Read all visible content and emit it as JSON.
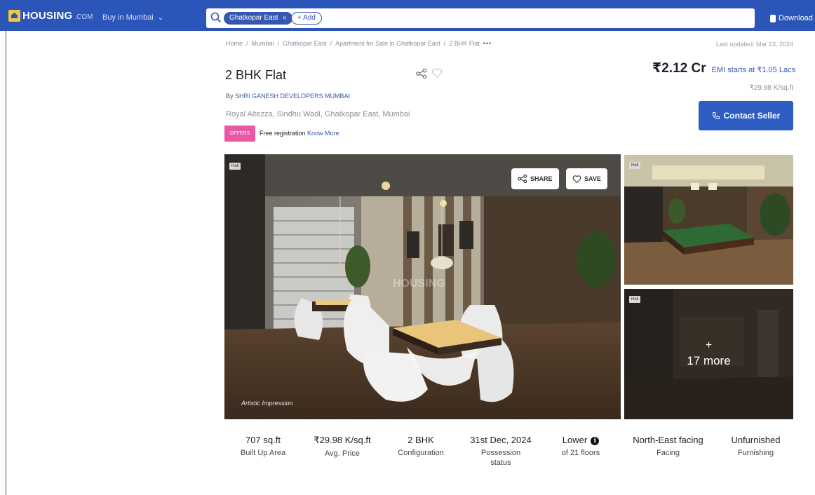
{
  "header": {
    "logo_text": "HOUSING",
    "logo_sub": ".COM",
    "city_select": "Buy in Mumbai",
    "search_chip": "Ghatkopar East",
    "add_label": "+ Add",
    "download_label": "Download A"
  },
  "breadcrumb": [
    "Home",
    "Mumbai",
    "Ghatkopar East",
    "Apartment for Sale in Ghatkopar East",
    "2 BHK Flat"
  ],
  "breadcrumb_more": "•••",
  "last_updated": "Last updated: Mar 23, 2024",
  "listing": {
    "title": "2 BHK Flat",
    "developer_prefix": "By",
    "developer": "SHRI GANESH DEVELOPERS MUMBAI",
    "address": "Royal Altezza, Sindhu Wadi, Ghatkopar East, Mumbai",
    "price": "₹2.12 Cr",
    "emi": "EMI starts at ₹1.05 Lacs",
    "price_per_sqft": "₹29.98 K/sq.ft",
    "offer_badge": "OFFERS",
    "offer_text": "Free registration",
    "offer_link": "Know More",
    "contact_label": "Contact Seller"
  },
  "gallery": {
    "main_tag": "Hall",
    "share_label": "SHARE",
    "save_label": "SAVE",
    "watermark": "HOUSING",
    "artistic": "Artistic Impression",
    "side1_tag": "Hall",
    "side2_tag": "Hall",
    "more_plus": "+",
    "more_label": "17 more"
  },
  "stats": [
    {
      "value": "707 sq.ft",
      "label": "Built Up Area"
    },
    {
      "value": "₹29.98 K/sq.ft",
      "label": "Avg. Price"
    },
    {
      "value": "2 BHK",
      "label": "Configuration"
    },
    {
      "value": "31st Dec, 2024",
      "label": "Possession status"
    },
    {
      "value": "Lower",
      "label": "of 21 floors"
    },
    {
      "value": "North-East facing",
      "label": "Facing"
    },
    {
      "value": "Unfurnished",
      "label": "Furnishing"
    }
  ],
  "colors": {
    "brand_blue": "#2b55b8",
    "button_blue": "#2e5ec4",
    "offer_pink": "#e858a4",
    "logo_yellow": "#f4c63b"
  },
  "icons": [
    "search-icon",
    "close-icon",
    "chevron-down-icon",
    "phone-icon",
    "share-icon",
    "heart-icon",
    "info-icon"
  ]
}
